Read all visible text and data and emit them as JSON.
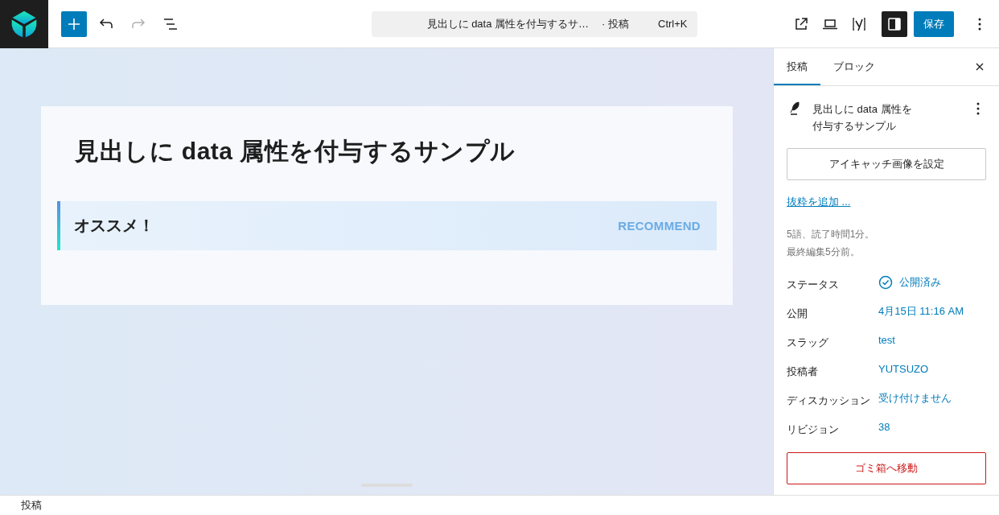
{
  "toolbar": {
    "redo": {
      "disabled": true
    },
    "command_bar": {
      "title": "見出しに data 属性を付与するサ…",
      "post_type": "· 投稿",
      "shortcut": "Ctrl+K"
    },
    "sidebar_toggle": {
      "pressed": true
    },
    "save_button": "保存"
  },
  "editor": {
    "title": "見出しに data 属性を付与するサンプル",
    "callout": {
      "heading": "オススメ！",
      "label": "RECOMMEND"
    }
  },
  "sidebar": {
    "tabs": [
      {
        "label": "投稿",
        "selected": true
      },
      {
        "label": "ブロック",
        "selected": false
      }
    ],
    "post_title": "見出しに data 属性を付与するサンプル",
    "featured_image_button": "アイキャッチ画像を設定",
    "excerpt_link": "抜粋を追加 ...",
    "stats": [
      "5語、読了時間1分。",
      "最終編集5分前。"
    ],
    "fields": [
      {
        "kind": "status",
        "label": "ステータス",
        "value": "公開済み"
      },
      {
        "kind": "link",
        "label": "公開",
        "value": "4月15日 11:16 AM"
      },
      {
        "kind": "link",
        "label": "スラッグ",
        "value": "test"
      },
      {
        "kind": "link",
        "label": "投稿者",
        "value": "YUTSUZO"
      },
      {
        "kind": "link",
        "label": "ディスカッション",
        "value": "受け付けません"
      },
      {
        "kind": "link",
        "label": "リビジョン",
        "value": "38"
      }
    ],
    "trash_button": "ゴミ箱へ移動"
  },
  "footer": {
    "breadcrumb": "投稿"
  }
}
